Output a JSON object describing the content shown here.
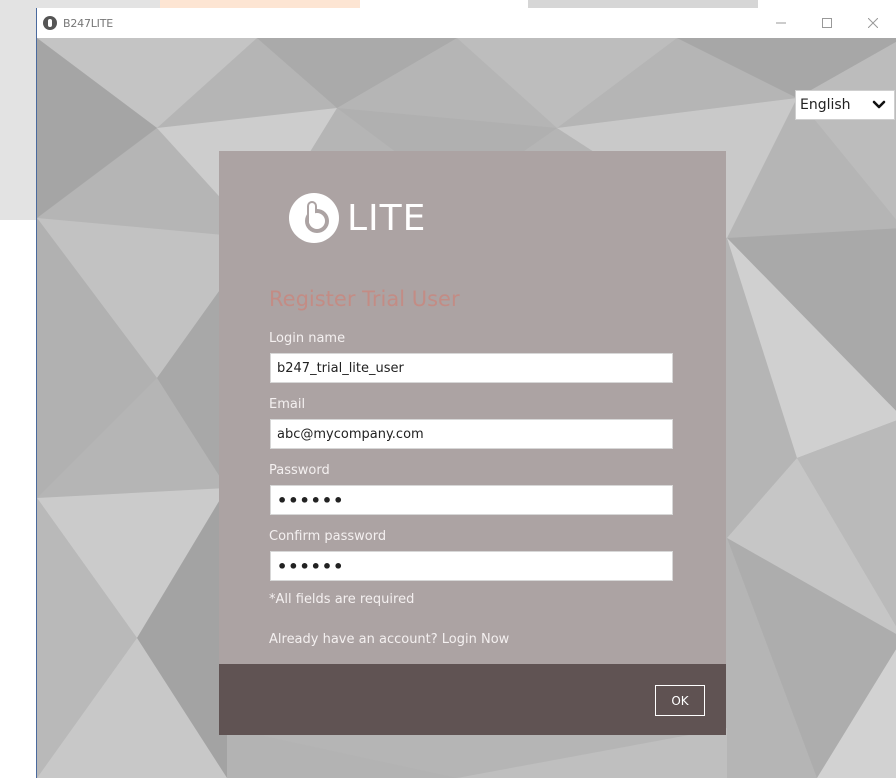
{
  "window": {
    "title": "B247LITE",
    "controls": {
      "minimize": "minimize-icon",
      "maximize": "maximize-icon",
      "close": "close-icon"
    }
  },
  "language": {
    "selected": "English",
    "icon": "chevron-down-icon"
  },
  "brand": {
    "logo_text": "LITE",
    "logo_icon": "b247-logo-icon"
  },
  "form": {
    "title": "Register Trial User",
    "fields": [
      {
        "label": "Login name",
        "value": "b247_trial_lite_user",
        "type": "text"
      },
      {
        "label": "Email",
        "value": "abc@mycompany.com",
        "type": "text"
      },
      {
        "label": "Password",
        "value": "••••••",
        "type": "password"
      },
      {
        "label": "Confirm password",
        "value": "••••••",
        "type": "password"
      }
    ],
    "required_note": "*All fields are required",
    "login_prompt": "Already have an account? Login Now",
    "ok_label": "OK"
  },
  "colors": {
    "card": "#aca3a3",
    "footer": "#605353",
    "title": "#c38c85",
    "window_border": "#4a6a9e"
  }
}
